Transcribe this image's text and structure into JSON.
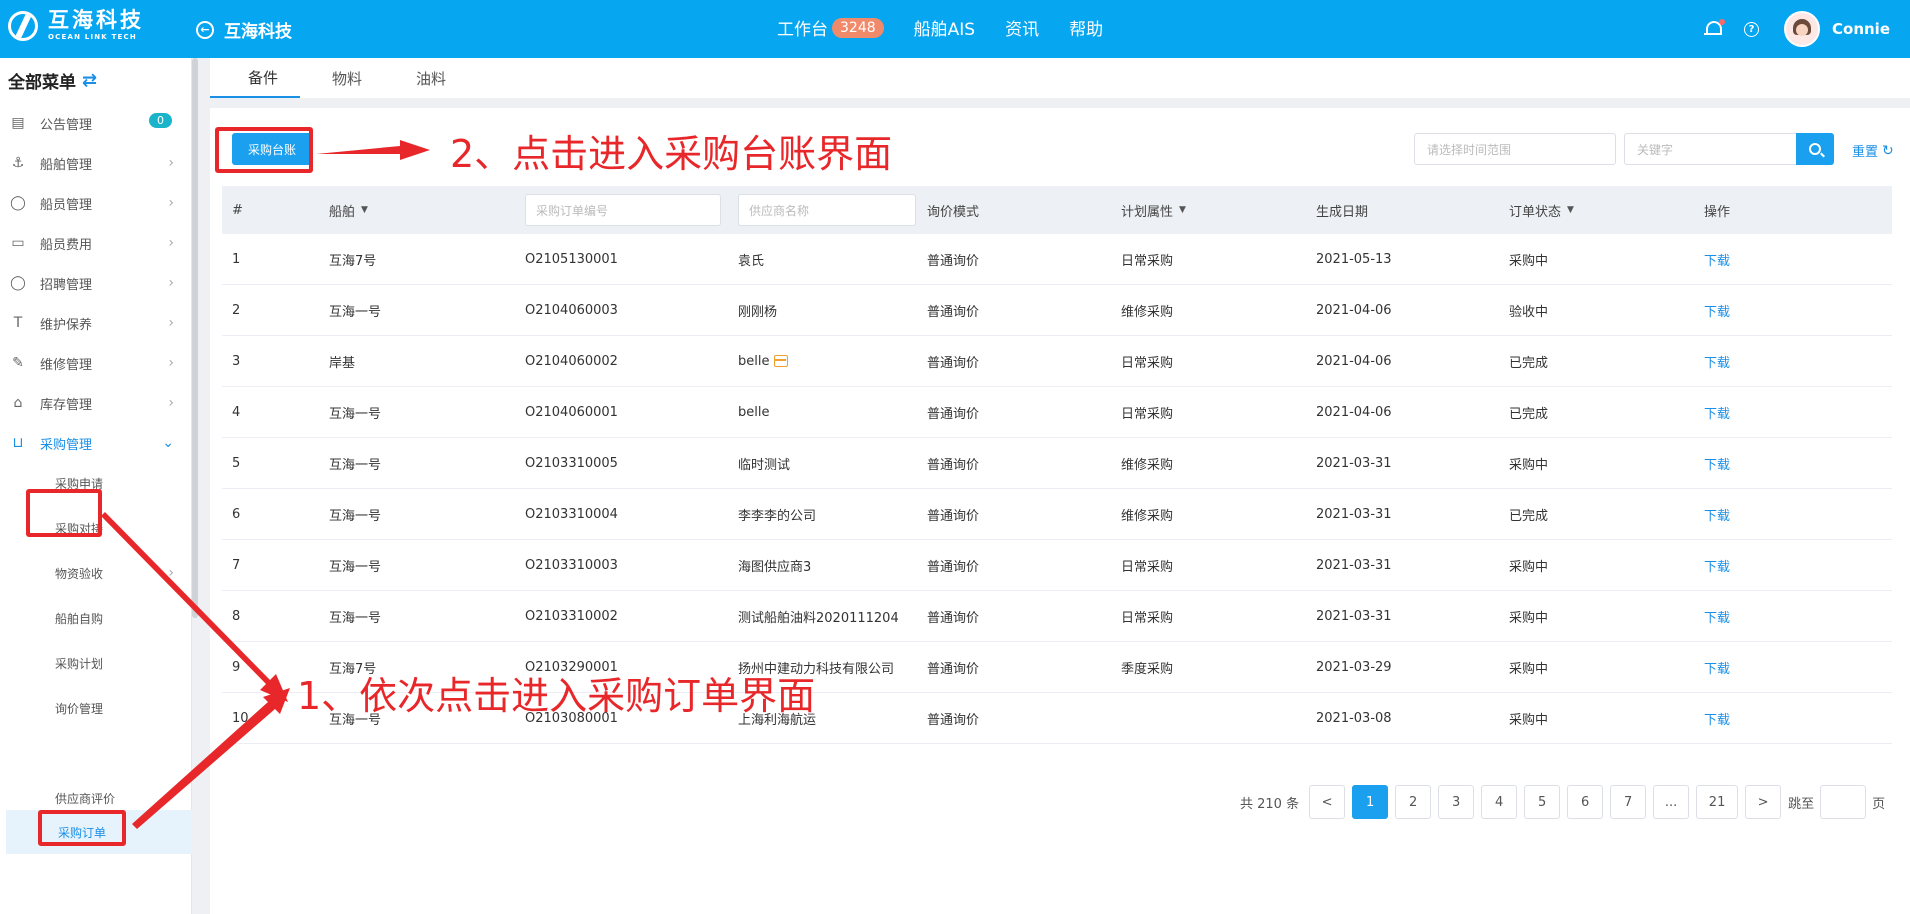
{
  "header": {
    "brand_cn": "互海科技",
    "brand_en": "OCEAN LINK TECH",
    "back_title": "互海科技",
    "nav": [
      {
        "label": "工作台",
        "badge": "3248"
      },
      {
        "label": "船舶AIS"
      },
      {
        "label": "资讯"
      },
      {
        "label": "帮助"
      }
    ],
    "user_name": "Connie"
  },
  "sidebar": {
    "title": "全部菜单",
    "items": [
      {
        "label": "公告管理",
        "badge": "0"
      },
      {
        "label": "船舶管理"
      },
      {
        "label": "船员管理"
      },
      {
        "label": "船员费用"
      },
      {
        "label": "招聘管理"
      },
      {
        "label": "维护保养"
      },
      {
        "label": "维修管理"
      },
      {
        "label": "库存管理"
      },
      {
        "label": "采购管理"
      }
    ],
    "sub_items": [
      {
        "label": "采购申请"
      },
      {
        "label": "采购对接"
      },
      {
        "label": "物资验收"
      },
      {
        "label": "船舶自购"
      },
      {
        "label": "采购计划"
      },
      {
        "label": "询价管理"
      },
      {
        "label": "采购订单"
      },
      {
        "label": "供应商评价"
      }
    ]
  },
  "tabs": [
    {
      "label": "备件"
    },
    {
      "label": "物料"
    },
    {
      "label": "油料"
    }
  ],
  "toolbar": {
    "ledger_button": "采购台账",
    "date_placeholder": "请选择时间范围",
    "keyword_placeholder": "关键字",
    "reset_label": "重置"
  },
  "table": {
    "headers": [
      "#",
      "船舶",
      "采购订单编号",
      "供应商名称",
      "询价模式",
      "计划属性",
      "生成日期",
      "订单状态",
      "操作"
    ],
    "rows": [
      [
        "1",
        "互海7号",
        "O2105130001",
        "袁氏",
        "普通询价",
        "日常采购",
        "2021-05-13",
        "采购中",
        "下载"
      ],
      [
        "2",
        "互海一号",
        "O2104060003",
        "刚刚杨",
        "普通询价",
        "维修采购",
        "2021-04-06",
        "验收中",
        "下载"
      ],
      [
        "3",
        "岸基",
        "O2104060002",
        "belle",
        "普通询价",
        "日常采购",
        "2021-04-06",
        "已完成",
        "下载"
      ],
      [
        "4",
        "互海一号",
        "O2104060001",
        "belle",
        "普通询价",
        "日常采购",
        "2021-04-06",
        "已完成",
        "下载"
      ],
      [
        "5",
        "互海一号",
        "O2103310005",
        "临时测试",
        "普通询价",
        "维修采购",
        "2021-03-31",
        "采购中",
        "下载"
      ],
      [
        "6",
        "互海一号",
        "O2103310004",
        "李李李的公司",
        "普通询价",
        "维修采购",
        "2021-03-31",
        "已完成",
        "下载"
      ],
      [
        "7",
        "互海一号",
        "O2103310003",
        "海图供应商3",
        "普通询价",
        "日常采购",
        "2021-03-31",
        "采购中",
        "下载"
      ],
      [
        "8",
        "互海一号",
        "O2103310002",
        "测试船舶油料2020111204",
        "普通询价",
        "日常采购",
        "2021-03-31",
        "采购中",
        "下载"
      ],
      [
        "9",
        "互海7号",
        "O2103290001",
        "扬州中建动力科技有限公司",
        "普通询价",
        "季度采购",
        "2021-03-29",
        "采购中",
        "下载"
      ],
      [
        "10",
        "互海一号",
        "O2103080001",
        "上海利海航运",
        "普通询价",
        "",
        "2021-03-08",
        "采购中",
        "下载"
      ]
    ]
  },
  "pagination": {
    "total_text": "共 210 条",
    "prev": "<",
    "pages": [
      "1",
      "2",
      "3",
      "4",
      "5",
      "6",
      "7",
      "...",
      "21"
    ],
    "next": ">",
    "jump_label": "跳至",
    "page_suffix": "页"
  },
  "annotations": {
    "step1": "1、依次点击进入采购订单界面",
    "step2": "2、点击进入采购台账界面",
    "color": "#e8272a"
  },
  "colors": {
    "header_bg": "#07a6f0",
    "accent": "#1aa0ef",
    "badge": "#f08a6a"
  }
}
